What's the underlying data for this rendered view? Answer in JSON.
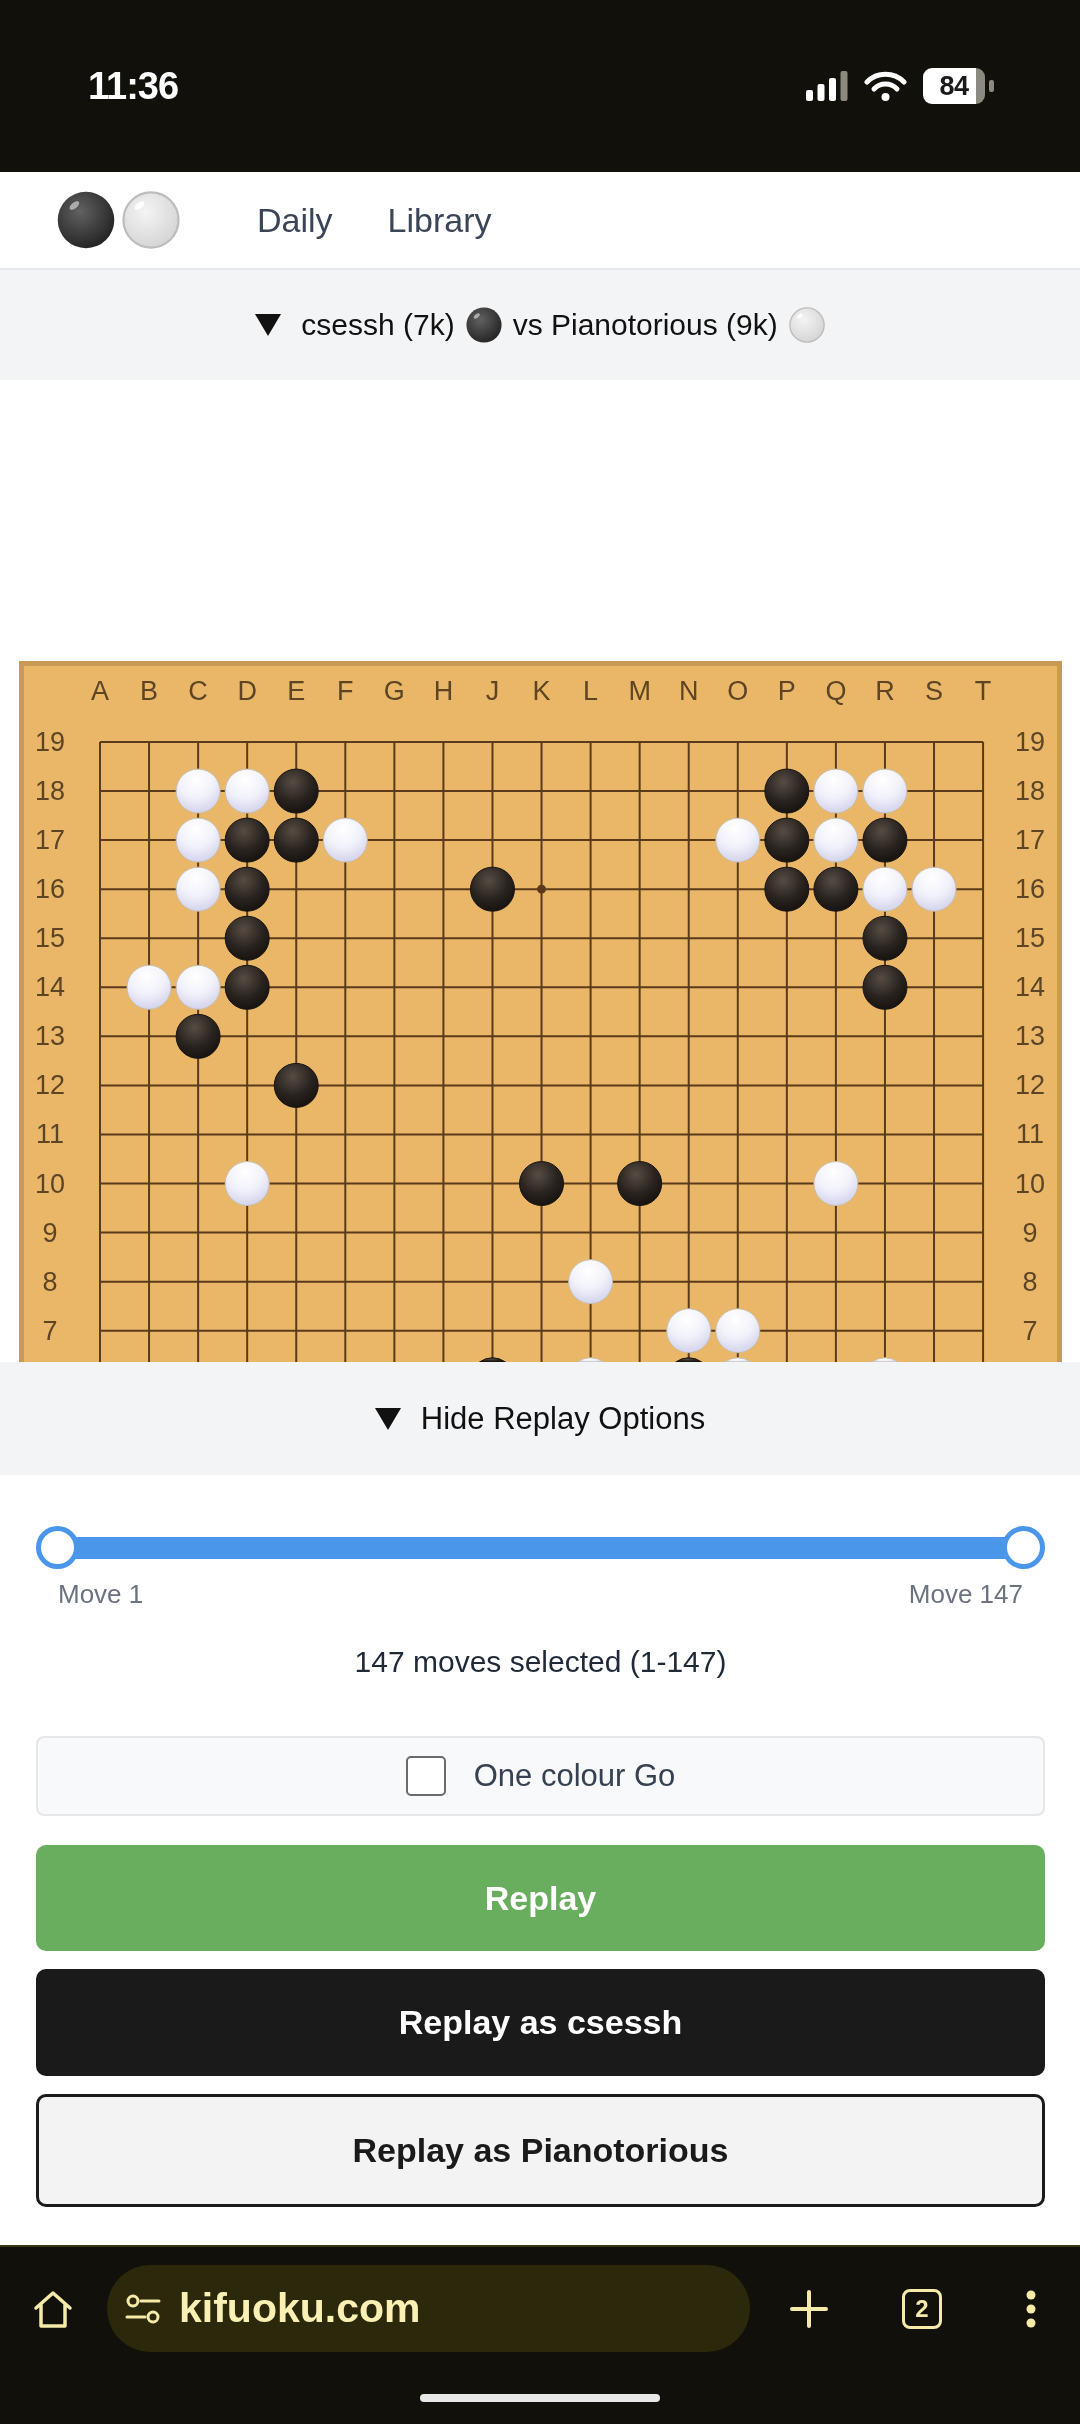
{
  "status_bar": {
    "time": "11:36",
    "battery": "84"
  },
  "nav": {
    "links": [
      "Daily",
      "Library"
    ]
  },
  "game_header": {
    "expanded": true,
    "players": [
      {
        "kind": "black",
        "label": "csessh (7k)"
      },
      {
        "kind": "white",
        "label": "vs Pianotorious (9k)"
      }
    ]
  },
  "board": {
    "columns": [
      "A",
      "B",
      "C",
      "D",
      "E",
      "F",
      "G",
      "H",
      "J",
      "K",
      "L",
      "M",
      "N",
      "O",
      "P",
      "Q",
      "R",
      "S",
      "T"
    ],
    "rows": [
      {
        "left_label": "19",
        "right_label": "19",
        "points": [
          {
            "kind": "empty"
          },
          {
            "kind": "empty"
          },
          {
            "kind": "empty"
          },
          {
            "kind": "empty"
          },
          {
            "kind": "empty"
          },
          {
            "kind": "empty"
          },
          {
            "kind": "empty"
          },
          {
            "kind": "empty"
          },
          {
            "kind": "empty"
          },
          {
            "kind": "empty"
          },
          {
            "kind": "empty"
          },
          {
            "kind": "empty"
          },
          {
            "kind": "empty"
          },
          {
            "kind": "empty"
          },
          {
            "kind": "empty"
          },
          {
            "kind": "empty"
          },
          {
            "kind": "empty"
          },
          {
            "kind": "empty"
          },
          {
            "kind": "empty"
          }
        ]
      },
      {
        "left_label": "18",
        "right_label": "18",
        "points": [
          {
            "kind": "empty"
          },
          {
            "kind": "empty"
          },
          {
            "kind": "white"
          },
          {
            "kind": "white"
          },
          {
            "kind": "black"
          },
          {
            "kind": "empty"
          },
          {
            "kind": "empty"
          },
          {
            "kind": "empty"
          },
          {
            "kind": "empty"
          },
          {
            "kind": "empty"
          },
          {
            "kind": "empty"
          },
          {
            "kind": "empty"
          },
          {
            "kind": "empty"
          },
          {
            "kind": "empty"
          },
          {
            "kind": "black"
          },
          {
            "kind": "white"
          },
          {
            "kind": "white"
          },
          {
            "kind": "empty"
          },
          {
            "kind": "empty"
          }
        ]
      },
      {
        "left_label": "17",
        "right_label": "17",
        "points": [
          {
            "kind": "empty"
          },
          {
            "kind": "empty"
          },
          {
            "kind": "white"
          },
          {
            "kind": "black"
          },
          {
            "kind": "black"
          },
          {
            "kind": "white"
          },
          {
            "kind": "empty"
          },
          {
            "kind": "empty"
          },
          {
            "kind": "empty"
          },
          {
            "kind": "empty"
          },
          {
            "kind": "empty"
          },
          {
            "kind": "empty"
          },
          {
            "kind": "empty"
          },
          {
            "kind": "white"
          },
          {
            "kind": "black"
          },
          {
            "kind": "white"
          },
          {
            "kind": "black"
          },
          {
            "kind": "empty"
          },
          {
            "kind": "empty"
          }
        ]
      },
      {
        "left_label": "16",
        "right_label": "16",
        "points": [
          {
            "kind": "empty"
          },
          {
            "kind": "empty"
          },
          {
            "kind": "white"
          },
          {
            "kind": "black"
          },
          {
            "kind": "empty"
          },
          {
            "kind": "empty"
          },
          {
            "kind": "empty"
          },
          {
            "kind": "empty"
          },
          {
            "kind": "black"
          },
          {
            "kind": "empty"
          },
          {
            "kind": "empty"
          },
          {
            "kind": "empty"
          },
          {
            "kind": "empty"
          },
          {
            "kind": "empty"
          },
          {
            "kind": "black"
          },
          {
            "kind": "black"
          },
          {
            "kind": "white"
          },
          {
            "kind": "white"
          },
          {
            "kind": "empty"
          }
        ]
      },
      {
        "left_label": "15",
        "right_label": "15",
        "points": [
          {
            "kind": "empty"
          },
          {
            "kind": "empty"
          },
          {
            "kind": "empty"
          },
          {
            "kind": "black"
          },
          {
            "kind": "empty"
          },
          {
            "kind": "empty"
          },
          {
            "kind": "empty"
          },
          {
            "kind": "empty"
          },
          {
            "kind": "empty"
          },
          {
            "kind": "empty"
          },
          {
            "kind": "empty"
          },
          {
            "kind": "empty"
          },
          {
            "kind": "empty"
          },
          {
            "kind": "empty"
          },
          {
            "kind": "empty"
          },
          {
            "kind": "empty"
          },
          {
            "kind": "black"
          },
          {
            "kind": "empty"
          },
          {
            "kind": "empty"
          }
        ]
      },
      {
        "left_label": "14",
        "right_label": "14",
        "points": [
          {
            "kind": "empty"
          },
          {
            "kind": "white"
          },
          {
            "kind": "white"
          },
          {
            "kind": "black"
          },
          {
            "kind": "empty"
          },
          {
            "kind": "empty"
          },
          {
            "kind": "empty"
          },
          {
            "kind": "empty"
          },
          {
            "kind": "empty"
          },
          {
            "kind": "empty"
          },
          {
            "kind": "empty"
          },
          {
            "kind": "empty"
          },
          {
            "kind": "empty"
          },
          {
            "kind": "empty"
          },
          {
            "kind": "empty"
          },
          {
            "kind": "empty"
          },
          {
            "kind": "black"
          },
          {
            "kind": "empty"
          },
          {
            "kind": "empty"
          }
        ]
      },
      {
        "left_label": "13",
        "right_label": "13",
        "points": [
          {
            "kind": "empty"
          },
          {
            "kind": "empty"
          },
          {
            "kind": "black"
          },
          {
            "kind": "empty"
          },
          {
            "kind": "empty"
          },
          {
            "kind": "empty"
          },
          {
            "kind": "empty"
          },
          {
            "kind": "empty"
          },
          {
            "kind": "empty"
          },
          {
            "kind": "empty"
          },
          {
            "kind": "empty"
          },
          {
            "kind": "empty"
          },
          {
            "kind": "empty"
          },
          {
            "kind": "empty"
          },
          {
            "kind": "empty"
          },
          {
            "kind": "empty"
          },
          {
            "kind": "empty"
          },
          {
            "kind": "empty"
          },
          {
            "kind": "empty"
          }
        ]
      },
      {
        "left_label": "12",
        "right_label": "12",
        "points": [
          {
            "kind": "empty"
          },
          {
            "kind": "empty"
          },
          {
            "kind": "empty"
          },
          {
            "kind": "empty"
          },
          {
            "kind": "black"
          },
          {
            "kind": "empty"
          },
          {
            "kind": "empty"
          },
          {
            "kind": "empty"
          },
          {
            "kind": "empty"
          },
          {
            "kind": "empty"
          },
          {
            "kind": "empty"
          },
          {
            "kind": "empty"
          },
          {
            "kind": "empty"
          },
          {
            "kind": "empty"
          },
          {
            "kind": "empty"
          },
          {
            "kind": "empty"
          },
          {
            "kind": "empty"
          },
          {
            "kind": "empty"
          },
          {
            "kind": "empty"
          }
        ]
      },
      {
        "left_label": "11",
        "right_label": "11",
        "points": [
          {
            "kind": "empty"
          },
          {
            "kind": "empty"
          },
          {
            "kind": "empty"
          },
          {
            "kind": "empty"
          },
          {
            "kind": "empty"
          },
          {
            "kind": "empty"
          },
          {
            "kind": "empty"
          },
          {
            "kind": "empty"
          },
          {
            "kind": "empty"
          },
          {
            "kind": "empty"
          },
          {
            "kind": "empty"
          },
          {
            "kind": "empty"
          },
          {
            "kind": "empty"
          },
          {
            "kind": "empty"
          },
          {
            "kind": "empty"
          },
          {
            "kind": "empty"
          },
          {
            "kind": "empty"
          },
          {
            "kind": "empty"
          },
          {
            "kind": "empty"
          }
        ]
      },
      {
        "left_label": "10",
        "right_label": "10",
        "points": [
          {
            "kind": "empty"
          },
          {
            "kind": "empty"
          },
          {
            "kind": "empty"
          },
          {
            "kind": "white"
          },
          {
            "kind": "empty"
          },
          {
            "kind": "empty"
          },
          {
            "kind": "empty"
          },
          {
            "kind": "empty"
          },
          {
            "kind": "empty"
          },
          {
            "kind": "black"
          },
          {
            "kind": "empty"
          },
          {
            "kind": "black"
          },
          {
            "kind": "empty"
          },
          {
            "kind": "empty"
          },
          {
            "kind": "empty"
          },
          {
            "kind": "white"
          },
          {
            "kind": "empty"
          },
          {
            "kind": "empty"
          },
          {
            "kind": "empty"
          }
        ]
      },
      {
        "left_label": "9",
        "right_label": "9",
        "points": [
          {
            "kind": "empty"
          },
          {
            "kind": "empty"
          },
          {
            "kind": "empty"
          },
          {
            "kind": "empty"
          },
          {
            "kind": "empty"
          },
          {
            "kind": "empty"
          },
          {
            "kind": "empty"
          },
          {
            "kind": "empty"
          },
          {
            "kind": "empty"
          },
          {
            "kind": "empty"
          },
          {
            "kind": "empty"
          },
          {
            "kind": "empty"
          },
          {
            "kind": "empty"
          },
          {
            "kind": "empty"
          },
          {
            "kind": "empty"
          },
          {
            "kind": "empty"
          },
          {
            "kind": "empty"
          },
          {
            "kind": "empty"
          },
          {
            "kind": "empty"
          }
        ]
      },
      {
        "left_label": "8",
        "right_label": "8",
        "points": [
          {
            "kind": "empty"
          },
          {
            "kind": "empty"
          },
          {
            "kind": "empty"
          },
          {
            "kind": "empty"
          },
          {
            "kind": "empty"
          },
          {
            "kind": "empty"
          },
          {
            "kind": "empty"
          },
          {
            "kind": "empty"
          },
          {
            "kind": "empty"
          },
          {
            "kind": "empty"
          },
          {
            "kind": "white"
          },
          {
            "kind": "empty"
          },
          {
            "kind": "empty"
          },
          {
            "kind": "empty"
          },
          {
            "kind": "empty"
          },
          {
            "kind": "empty"
          },
          {
            "kind": "empty"
          },
          {
            "kind": "empty"
          },
          {
            "kind": "empty"
          }
        ]
      },
      {
        "left_label": "7",
        "right_label": "7",
        "points": [
          {
            "kind": "empty"
          },
          {
            "kind": "empty"
          },
          {
            "kind": "empty"
          },
          {
            "kind": "empty"
          },
          {
            "kind": "empty"
          },
          {
            "kind": "empty"
          },
          {
            "kind": "empty"
          },
          {
            "kind": "empty"
          },
          {
            "kind": "empty"
          },
          {
            "kind": "empty"
          },
          {
            "kind": "empty"
          },
          {
            "kind": "empty"
          },
          {
            "kind": "white"
          },
          {
            "kind": "white"
          },
          {
            "kind": "empty"
          },
          {
            "kind": "empty"
          },
          {
            "kind": "empty"
          },
          {
            "kind": "empty"
          },
          {
            "kind": "empty"
          }
        ]
      },
      {
        "points": [
          {
            "kind": "empty"
          },
          {
            "kind": "empty"
          },
          {
            "kind": "empty"
          },
          {
            "kind": "empty"
          },
          {
            "kind": "empty"
          },
          {
            "kind": "empty"
          },
          {
            "kind": "empty"
          },
          {
            "kind": "empty"
          },
          {
            "kind": "black"
          },
          {
            "kind": "empty"
          },
          {
            "kind": "white"
          },
          {
            "kind": "empty"
          },
          {
            "kind": "black"
          },
          {
            "kind": "white"
          },
          {
            "kind": "empty"
          },
          {
            "kind": "empty"
          },
          {
            "kind": "white"
          },
          {
            "kind": "empty"
          },
          {
            "kind": "empty"
          }
        ]
      }
    ]
  },
  "replay_options": {
    "expanded": true,
    "toggle_label": "Hide Replay Options",
    "range_slider": {
      "thumbs": [
        {
          "level": 0
        },
        {
          "level": 1
        }
      ],
      "start_label": "Move 1",
      "end_label": "Move 147"
    },
    "selection_summary": "147 moves selected (1-147)",
    "one_colour_go": {
      "label": "One colour Go",
      "checked": false
    },
    "buttons": [
      {
        "kind": "primary",
        "label": "Replay"
      },
      {
        "kind": "dark",
        "label": "Replay as csessh"
      },
      {
        "kind": "outline",
        "label": "Replay as Pianotorious"
      }
    ]
  },
  "browser_bar": {
    "url": "kifuoku.com",
    "tab_count": "2"
  }
}
